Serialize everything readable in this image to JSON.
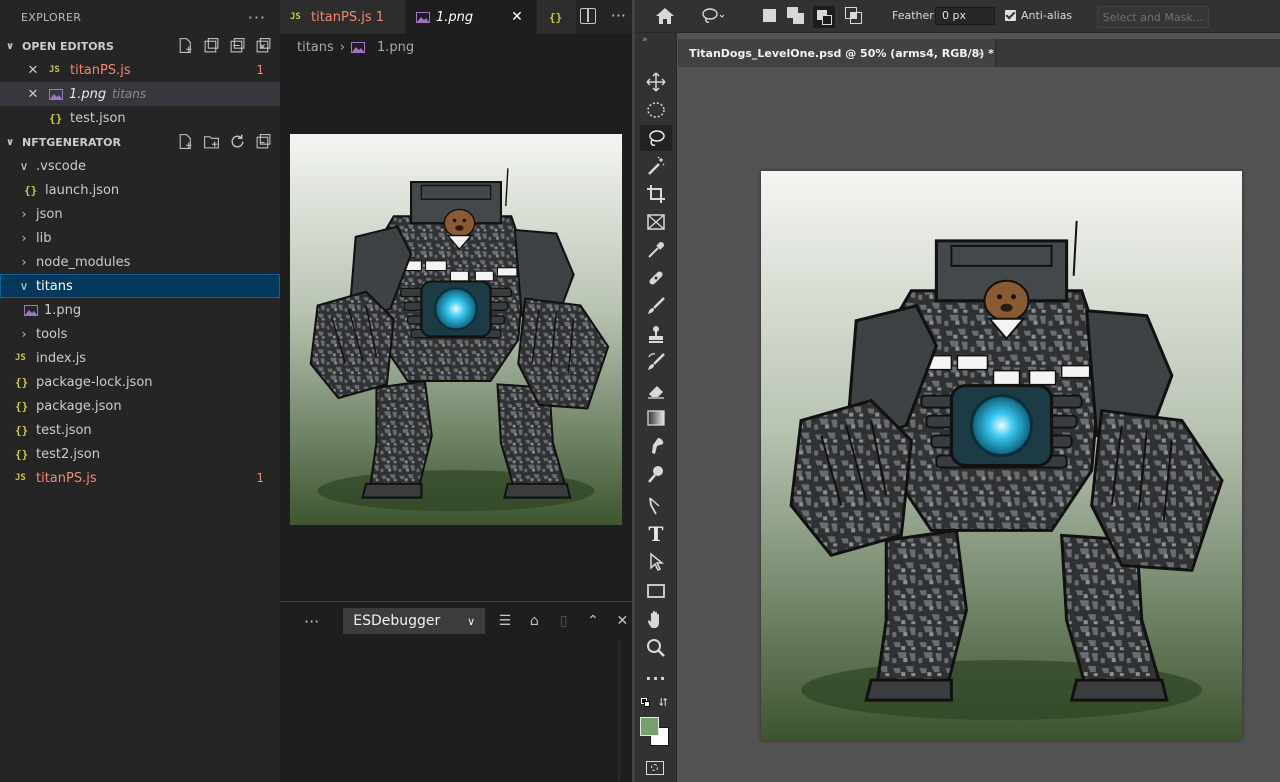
{
  "explorer": {
    "title": "EXPLORER",
    "more": "···",
    "open_editors": {
      "title": "OPEN EDITORS",
      "items": [
        {
          "name": "titanPS.js",
          "badge": "1"
        },
        {
          "name": "1.png",
          "folder": "titans"
        },
        {
          "name": "test.json"
        }
      ]
    },
    "project": {
      "title": "NFTGENERATOR",
      "tree": {
        "vscode": ".vscode",
        "launch": "launch.json",
        "json": "json",
        "lib": "lib",
        "node_modules": "node_modules",
        "titans": "titans",
        "png": "1.png",
        "tools": "tools",
        "index": "index.js",
        "package_lock": "package-lock.json",
        "package": "package.json",
        "test": "test.json",
        "test2": "test2.json",
        "titanps": "titanPS.js",
        "titanps_badge": "1"
      }
    }
  },
  "editor": {
    "tabs": [
      {
        "label": "titanPS.js 1"
      },
      {
        "label": "1.png"
      }
    ],
    "breadcrumb": [
      "titans",
      "1.png"
    ],
    "panel": {
      "more": "···",
      "dropdown": "ESDebugger"
    }
  },
  "photoshop": {
    "feather_label": "Feather:",
    "feather_value": "0 px",
    "antialias_label": "Anti-alias",
    "antialias_checked": true,
    "select_mask": "Select and Mask...",
    "doc_tab": "TitanDogs_LevelOne.psd @ 50% (arms4, RGB/8) *",
    "doc_close": "×",
    "foreground_color": "#7a9f6e",
    "background_color": "#ffffff",
    "tools": [
      "move-tool",
      "marquee-tool",
      "lasso-tool",
      "magic-wand-tool",
      "crop-tool",
      "frame-tool",
      "eyedropper-tool",
      "healing-brush-tool",
      "brush-tool",
      "clone-stamp-tool",
      "history-brush-tool",
      "eraser-tool",
      "gradient-tool",
      "smudge-tool",
      "dodge-tool",
      "pen-tool",
      "type-tool",
      "path-selection-tool",
      "rectangle-tool",
      "hand-tool",
      "zoom-tool",
      "more-tools"
    ],
    "tool_type_glyph": "T"
  },
  "theme": {
    "vscode_accent": "#0e639c",
    "error": "#f48771",
    "js_icon": "#cbcb41"
  }
}
